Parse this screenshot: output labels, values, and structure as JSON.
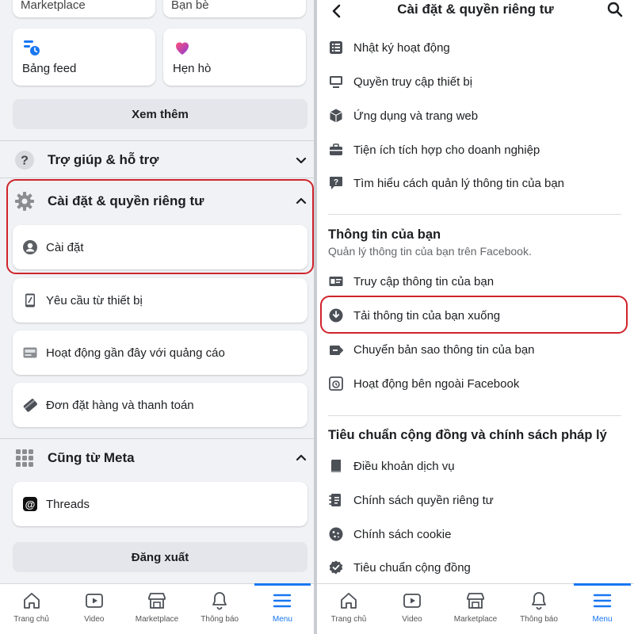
{
  "left": {
    "top_cards": [
      "Marketplace",
      "Bạn bè"
    ],
    "shortcuts": [
      {
        "label": "Bảng feed",
        "icon": "feed-icon"
      },
      {
        "label": "Hẹn hò",
        "icon": "dating-heart-icon"
      }
    ],
    "see_more": "Xem thêm",
    "help_section": "Trợ giúp & hỗ trợ",
    "settings_section": "Cài đặt & quyền riêng tư",
    "settings_items": [
      {
        "label": "Cài đặt",
        "icon": "profile-settings-icon"
      },
      {
        "label": "Yêu cầu từ thiết bị",
        "icon": "device-icon"
      },
      {
        "label": "Hoạt động gần đây với quảng cáo",
        "icon": "ad-activity-icon"
      },
      {
        "label": "Đơn đặt hàng và thanh toán",
        "icon": "payment-tag-icon"
      }
    ],
    "meta_section": "Cũng từ Meta",
    "meta_items": [
      {
        "label": "Threads",
        "icon": "threads-icon"
      }
    ],
    "logout": "Đăng xuất"
  },
  "tabs": [
    {
      "label": "Trang chủ",
      "icon": "home-icon"
    },
    {
      "label": "Video",
      "icon": "video-icon"
    },
    {
      "label": "Marketplace",
      "icon": "marketplace-icon"
    },
    {
      "label": "Thông báo",
      "icon": "bell-icon"
    },
    {
      "label": "Menu",
      "icon": "menu-icon",
      "active": true
    }
  ],
  "right": {
    "title": "Cài đặt & quyền riêng tư",
    "group1": [
      {
        "label": "Nhật ký hoạt động",
        "icon": "activity-log-icon"
      },
      {
        "label": "Quyền truy cập thiết bị",
        "icon": "device-access-icon"
      },
      {
        "label": "Ứng dụng và trang web",
        "icon": "apps-cube-icon"
      },
      {
        "label": "Tiện ích tích hợp cho doanh nghiệp",
        "icon": "briefcase-icon"
      },
      {
        "label": "Tìm hiểu cách quản lý thông tin của bạn",
        "icon": "help-bubble-icon"
      }
    ],
    "your_info_heading": "Thông tin của bạn",
    "your_info_sub": "Quản lý thông tin của bạn trên Facebook.",
    "group2": [
      {
        "label": "Truy cập thông tin của bạn",
        "icon": "id-card-icon"
      },
      {
        "label": "Tải thông tin của bạn xuống",
        "icon": "download-icon"
      },
      {
        "label": "Chuyển bản sao thông tin của bạn",
        "icon": "transfer-icon"
      },
      {
        "label": "Hoạt động bên ngoài Facebook",
        "icon": "off-facebook-icon"
      }
    ],
    "policy_heading": "Tiêu chuẩn cộng đồng và chính sách pháp lý",
    "group3": [
      {
        "label": "Điều khoản dịch vụ",
        "icon": "terms-book-icon"
      },
      {
        "label": "Chính sách quyền riêng tư",
        "icon": "privacy-policy-icon"
      },
      {
        "label": "Chính sách cookie",
        "icon": "cookie-icon"
      },
      {
        "label": "Tiêu chuẩn cộng đồng",
        "icon": "community-badge-icon"
      }
    ]
  },
  "colors": {
    "accent": "#1877f2",
    "highlight": "#d0242b"
  }
}
